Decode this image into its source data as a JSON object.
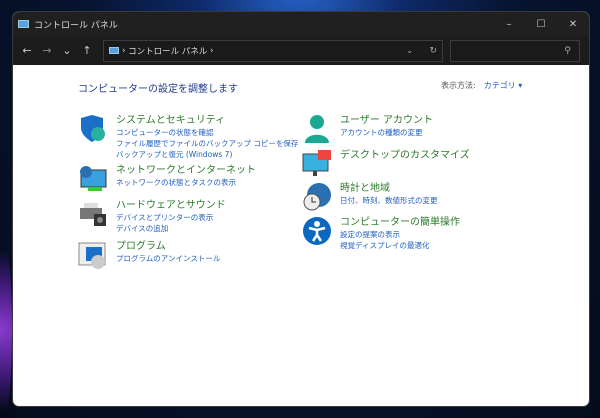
{
  "window": {
    "title": "コントロール パネル",
    "minimize": "–",
    "maximize": "☐",
    "close": "✕"
  },
  "toolbar": {
    "back": "←",
    "forward": "→",
    "recent": "⌄",
    "up": "↑",
    "breadcrumb": "コントロール パネル",
    "sep": "›",
    "dropdown": "⌄",
    "refresh": "↻",
    "search_icon": "⚲",
    "search_placeholder": ""
  },
  "content": {
    "heading": "コンピューターの設定を調整します",
    "view_label": "表示方法:",
    "view_value": "カテゴリ ▾",
    "left": [
      {
        "title": "システムとセキュリティ",
        "links": [
          "コンピューターの状態を確認",
          "ファイル履歴でファイルのバックアップ コピーを保存",
          "バックアップと復元 (Windows 7)"
        ]
      },
      {
        "title": "ネットワークとインターネット",
        "links": [
          "ネットワークの状態とタスクの表示"
        ]
      },
      {
        "title": "ハードウェアとサウンド",
        "links": [
          "デバイスとプリンターの表示",
          "デバイスの追加"
        ]
      },
      {
        "title": "プログラム",
        "links": [
          "プログラムのアンインストール"
        ]
      }
    ],
    "right": [
      {
        "title": "ユーザー アカウント",
        "links": [
          "アカウントの種類の変更"
        ]
      },
      {
        "title": "デスクトップのカスタマイズ",
        "links": []
      },
      {
        "title": "時計と地域",
        "links": [
          "日付、時刻、数値形式の変更"
        ]
      },
      {
        "title": "コンピューターの簡単操作",
        "links": [
          "設定の提案の表示",
          "視覚ディスプレイの最適化"
        ]
      }
    ]
  }
}
